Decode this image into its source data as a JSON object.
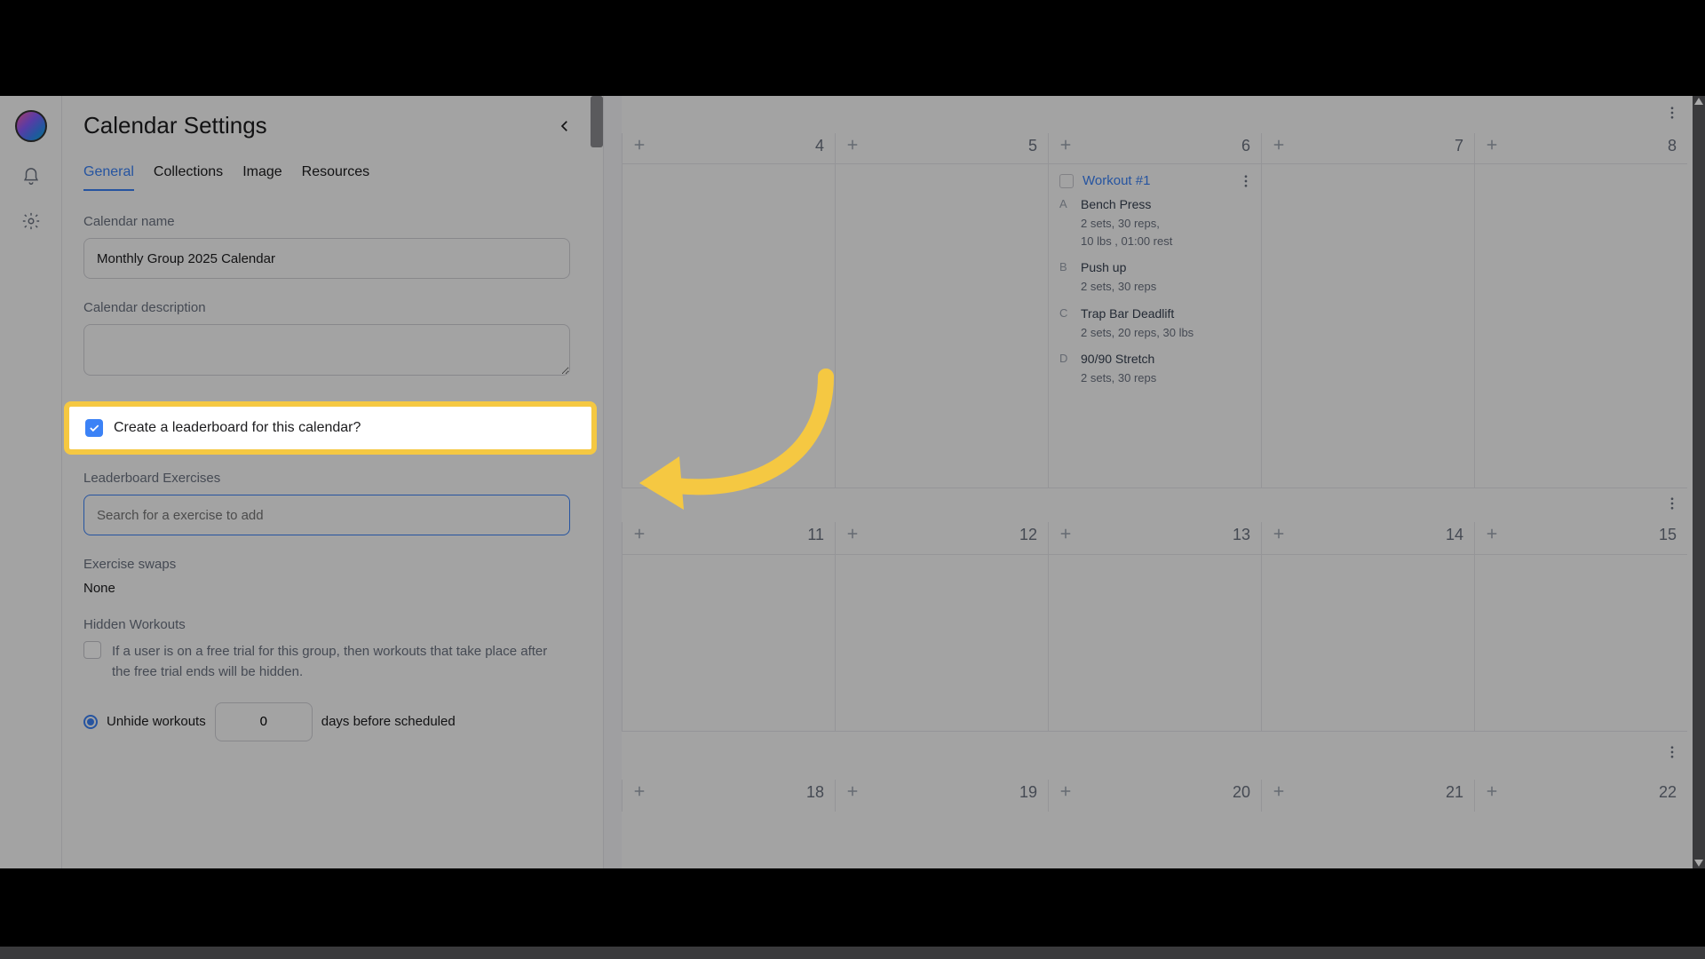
{
  "panel": {
    "title": "Calendar Settings",
    "tabs": [
      "General",
      "Collections",
      "Image",
      "Resources"
    ],
    "activeTab": 0,
    "calendarNameLabel": "Calendar name",
    "calendarName": "Monthly Group 2025 Calendar",
    "descriptionLabel": "Calendar description",
    "description": "",
    "createLeaderboardLabel": "Create a leaderboard for this calendar?",
    "leaderboardExercisesLabel": "Leaderboard Exercises",
    "searchPlaceholder": "Search for a exercise to add",
    "exerciseSwapsLabel": "Exercise swaps",
    "exerciseSwapsValue": "None",
    "hiddenWorkoutsLabel": "Hidden Workouts",
    "hiddenWorkoutsHelp": "If a user is on a free trial for this group, then workouts that take place after the free trial ends will be hidden.",
    "unhidePrefix": "Unhide workouts",
    "unhideDays": "0",
    "unhideSuffix": "days before scheduled"
  },
  "calendar": {
    "row1": [
      "4",
      "5",
      "6",
      "7",
      "8"
    ],
    "row2": [
      "11",
      "12",
      "13",
      "14",
      "15"
    ],
    "row3": [
      "18",
      "19",
      "20",
      "21",
      "22"
    ],
    "workout": {
      "title": "Workout #1",
      "exercises": [
        {
          "letter": "A",
          "name": "Bench Press",
          "detail": "2 sets, 30 reps,\n10 lbs , 01:00 rest"
        },
        {
          "letter": "B",
          "name": "Push up",
          "detail": "2 sets, 30 reps"
        },
        {
          "letter": "C",
          "name": "Trap Bar Deadlift",
          "detail": "2 sets, 20 reps, 30 lbs"
        },
        {
          "letter": "D",
          "name": "90/90 Stretch",
          "detail": "2 sets, 30 reps"
        }
      ]
    }
  },
  "colors": {
    "accent": "#3b82f6",
    "highlight": "#f5c842"
  }
}
